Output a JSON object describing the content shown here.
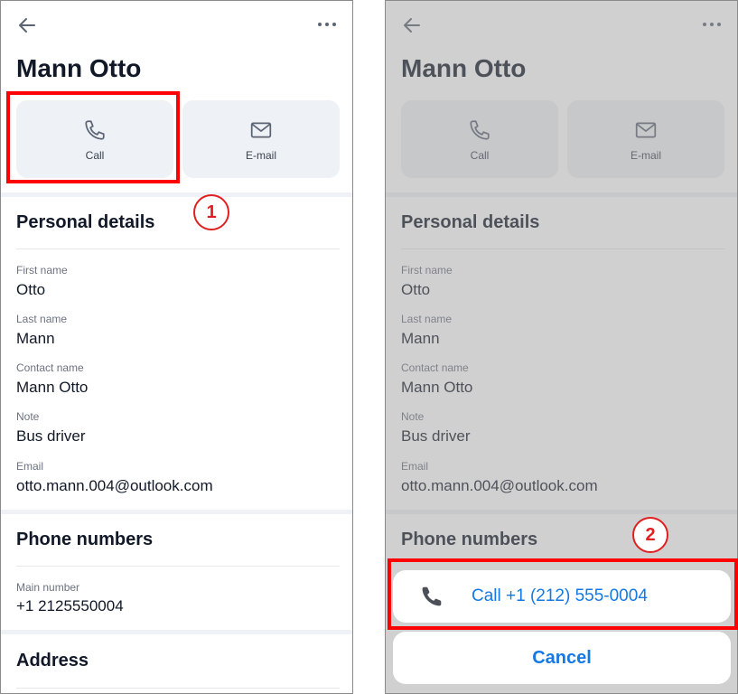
{
  "contact": {
    "name": "Mann Otto",
    "actions": {
      "call_label": "Call",
      "email_label": "E-mail"
    }
  },
  "personal_details": {
    "heading": "Personal details",
    "fields": [
      {
        "label": "First name",
        "value": "Otto"
      },
      {
        "label": "Last name",
        "value": "Mann"
      },
      {
        "label": "Contact name",
        "value": "Mann Otto"
      },
      {
        "label": "Note",
        "value": "Bus driver"
      },
      {
        "label": "Email",
        "value": "otto.mann.004@outlook.com"
      }
    ]
  },
  "phone_numbers": {
    "heading": "Phone numbers",
    "main_label": "Main number",
    "main_value": "+1 2125550004"
  },
  "address": {
    "heading": "Address"
  },
  "action_sheet": {
    "call_text": "Call +1 (212) 555-0004",
    "cancel_text": "Cancel"
  },
  "annotations": {
    "step1": "1",
    "step2": "2"
  },
  "icons": {
    "back": "arrow-left-icon",
    "more": "more-horizontal-icon",
    "call": "phone-icon",
    "email": "envelope-icon"
  },
  "colors": {
    "accent_blue": "#1479e4",
    "button_bg": "#eef1f5",
    "highlight_red": "#ff0000",
    "overlay_gray": "#969696"
  }
}
